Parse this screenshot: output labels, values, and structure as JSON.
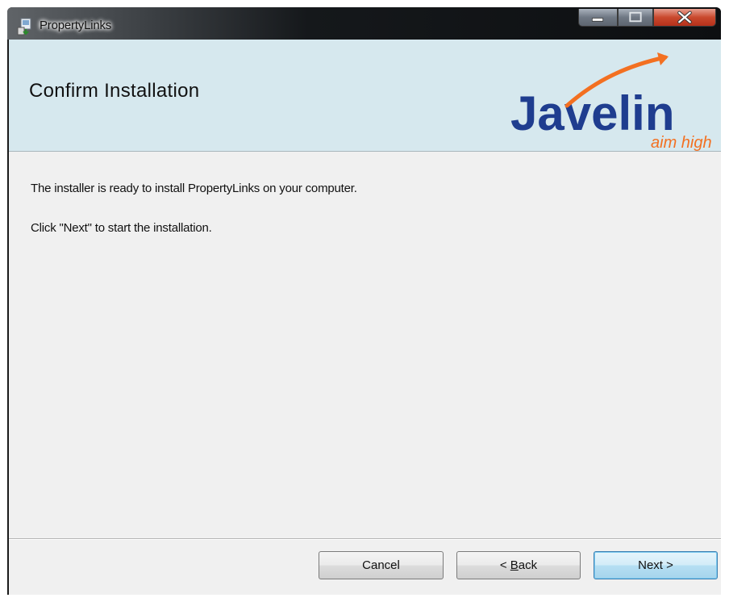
{
  "window": {
    "title": "PropertyLinks",
    "controls": {
      "minimize_icon": "minimize-icon",
      "maximize_icon": "maximize-icon",
      "close_icon": "close-icon"
    }
  },
  "header": {
    "title": "Confirm Installation",
    "background_color": "#d6e8ee",
    "logo": {
      "brand_text": "Javelin",
      "tagline": "aim high",
      "brand_color": "#1f3d8f",
      "accent_color": "#f37021"
    }
  },
  "body": {
    "line1": "The installer is ready to install PropertyLinks on your computer.",
    "line2": "Click \"Next\" to start the installation."
  },
  "buttons": {
    "cancel": "Cancel",
    "back_prefix": "< ",
    "back_mnemonic": "B",
    "back_rest": "ack",
    "next": "Next >"
  }
}
